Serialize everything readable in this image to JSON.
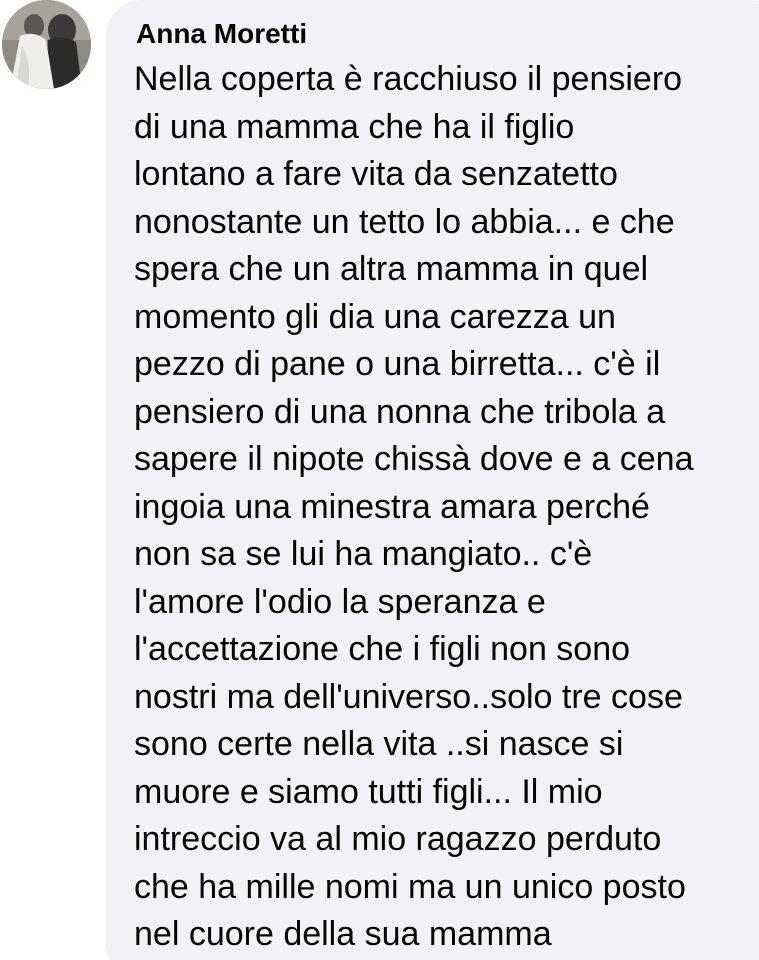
{
  "comment": {
    "author": "Anna Moretti",
    "lines": [
      "Nella coperta è racchiuso il pensiero",
      "di una mamma che ha il figlio",
      "lontano a fare vita da senzatetto",
      "nonostante un tetto lo abbia... e che",
      "spera che un altra mamma in quel",
      "momento gli dia una carezza un",
      "pezzo di pane o una birretta... c'è il",
      "pensiero di una nonna che tribola a",
      "sapere il nipote chissà dove e a cena",
      "ingoia una minestra amara perché",
      "non sa se lui ha mangiato.. c'è",
      "l'amore l'odio la speranza e",
      "l'accettazione che i figli non sono",
      "nostri ma dell'universo..solo tre cose",
      "sono certe nella vita ..si nasce si",
      "muore e siamo tutti figli... Il mio",
      "intreccio va al mio ragazzo perduto",
      "che ha mille nomi ma un unico posto",
      "nel cuore della sua mamma"
    ]
  },
  "colors": {
    "bubble_background": "#f0f2f5",
    "text": "#050505"
  }
}
